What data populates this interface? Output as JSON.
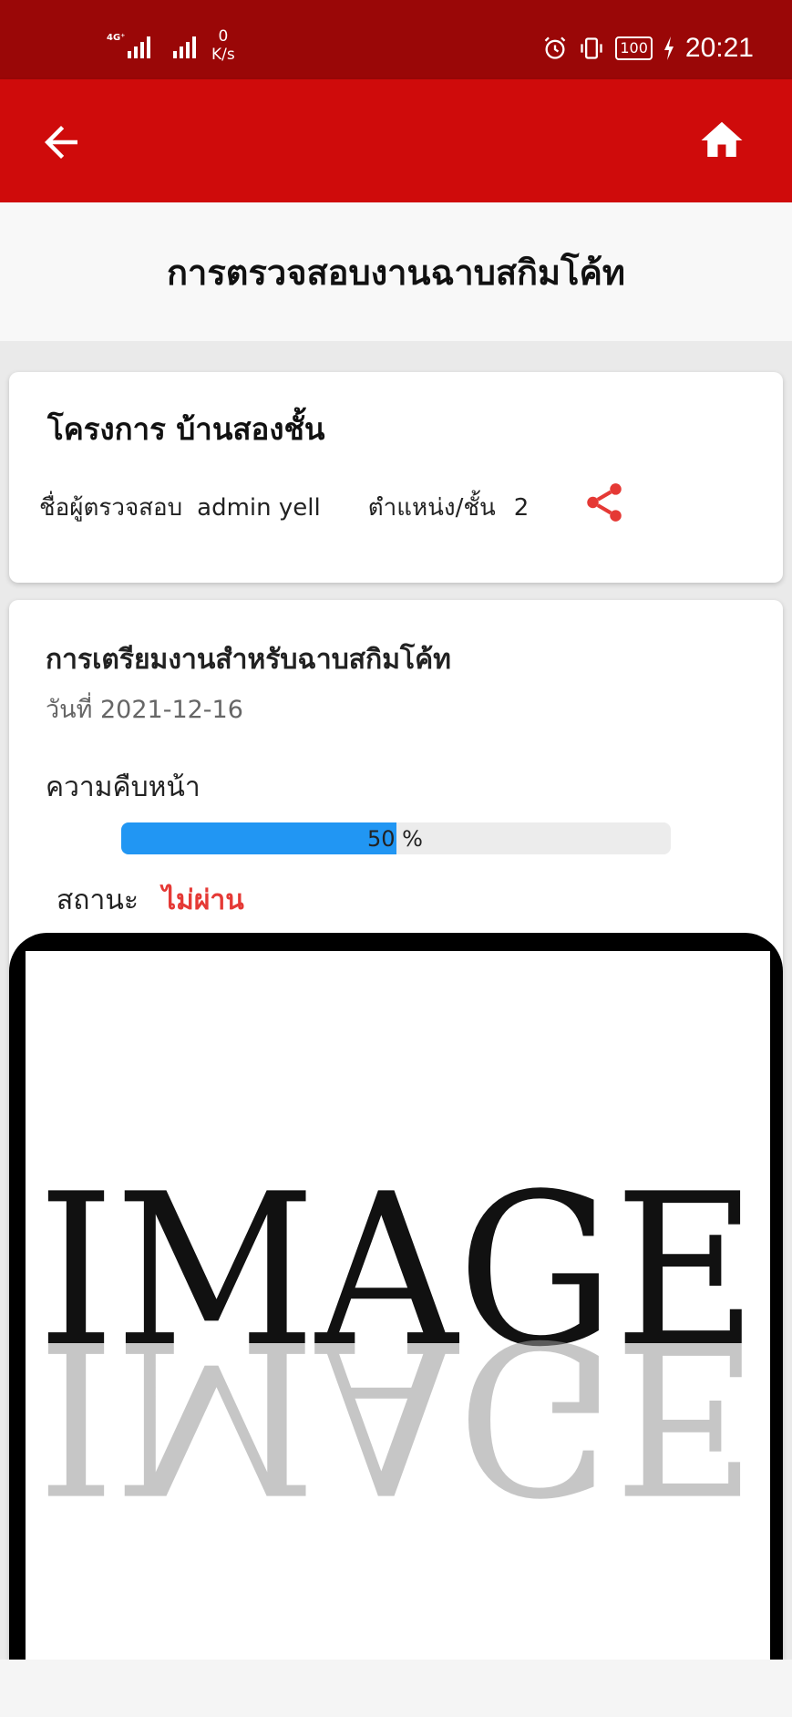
{
  "status_bar": {
    "network": "4G⁺",
    "speed_value": "0",
    "speed_unit": "K/s",
    "battery": "100",
    "time": "20:21"
  },
  "app_bar": {
    "back_icon": "arrow-left-icon",
    "home_icon": "home-icon"
  },
  "page": {
    "title": "การตรวจสอบงานฉาบสกิมโค้ท"
  },
  "project_card": {
    "project_name": "โครงการ บ้านสองชั้น",
    "inspector_label": "ชื่อผู้ตรวจสอบ",
    "inspector_name": "admin yell",
    "position_label": "ตำแหน่ง/ชั้น",
    "position_value": "2",
    "share_icon": "share-icon",
    "accent_color": "#e53935"
  },
  "task_card": {
    "title": "การเตรียมงานสำหรับฉาบสกิมโค้ท",
    "date": "วันที่ 2021-12-16",
    "progress_label": "ความคืบหน้า",
    "progress_percent": 50,
    "progress_text": "50 %",
    "progress_color": "#2196f3",
    "status_label": "สถานะ",
    "status_value": "ไม่ผ่าน",
    "status_color": "#e53935",
    "image_text": "IMAGE"
  }
}
